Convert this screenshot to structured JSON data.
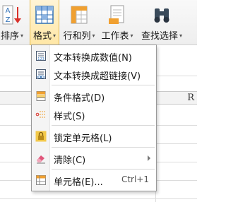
{
  "ribbon": {
    "sort_label": "排序",
    "format_label": "格式",
    "rowcol_label": "行和列",
    "worksheet_label": "工作表",
    "find_label": "查找选择",
    "sort_icon_text": "A\nZ"
  },
  "sheet": {
    "column_r": "R"
  },
  "menu": {
    "items": [
      {
        "label": "文本转换成数值(N)",
        "icon": "text-to-number-icon"
      },
      {
        "label": "文本转换成超链接(V)",
        "icon": "text-to-hyperlink-icon"
      },
      {
        "label": "条件格式(D)",
        "icon": "conditional-format-icon"
      },
      {
        "label": "样式(S)",
        "icon": "style-icon"
      },
      {
        "label": "锁定单元格(L)",
        "icon": "lock-icon"
      },
      {
        "label": "清除(C)",
        "icon": "eraser-icon"
      },
      {
        "label": "单元格(E)...",
        "icon": "cell-format-icon",
        "shortcut": "Ctrl+1"
      }
    ]
  },
  "colors": {
    "active_bg": "#ffe7a6",
    "active_border": "#e2b94f",
    "icon_blue": "#2f6fb6",
    "icon_orange": "#f0a030",
    "icon_red": "#d9312a"
  }
}
